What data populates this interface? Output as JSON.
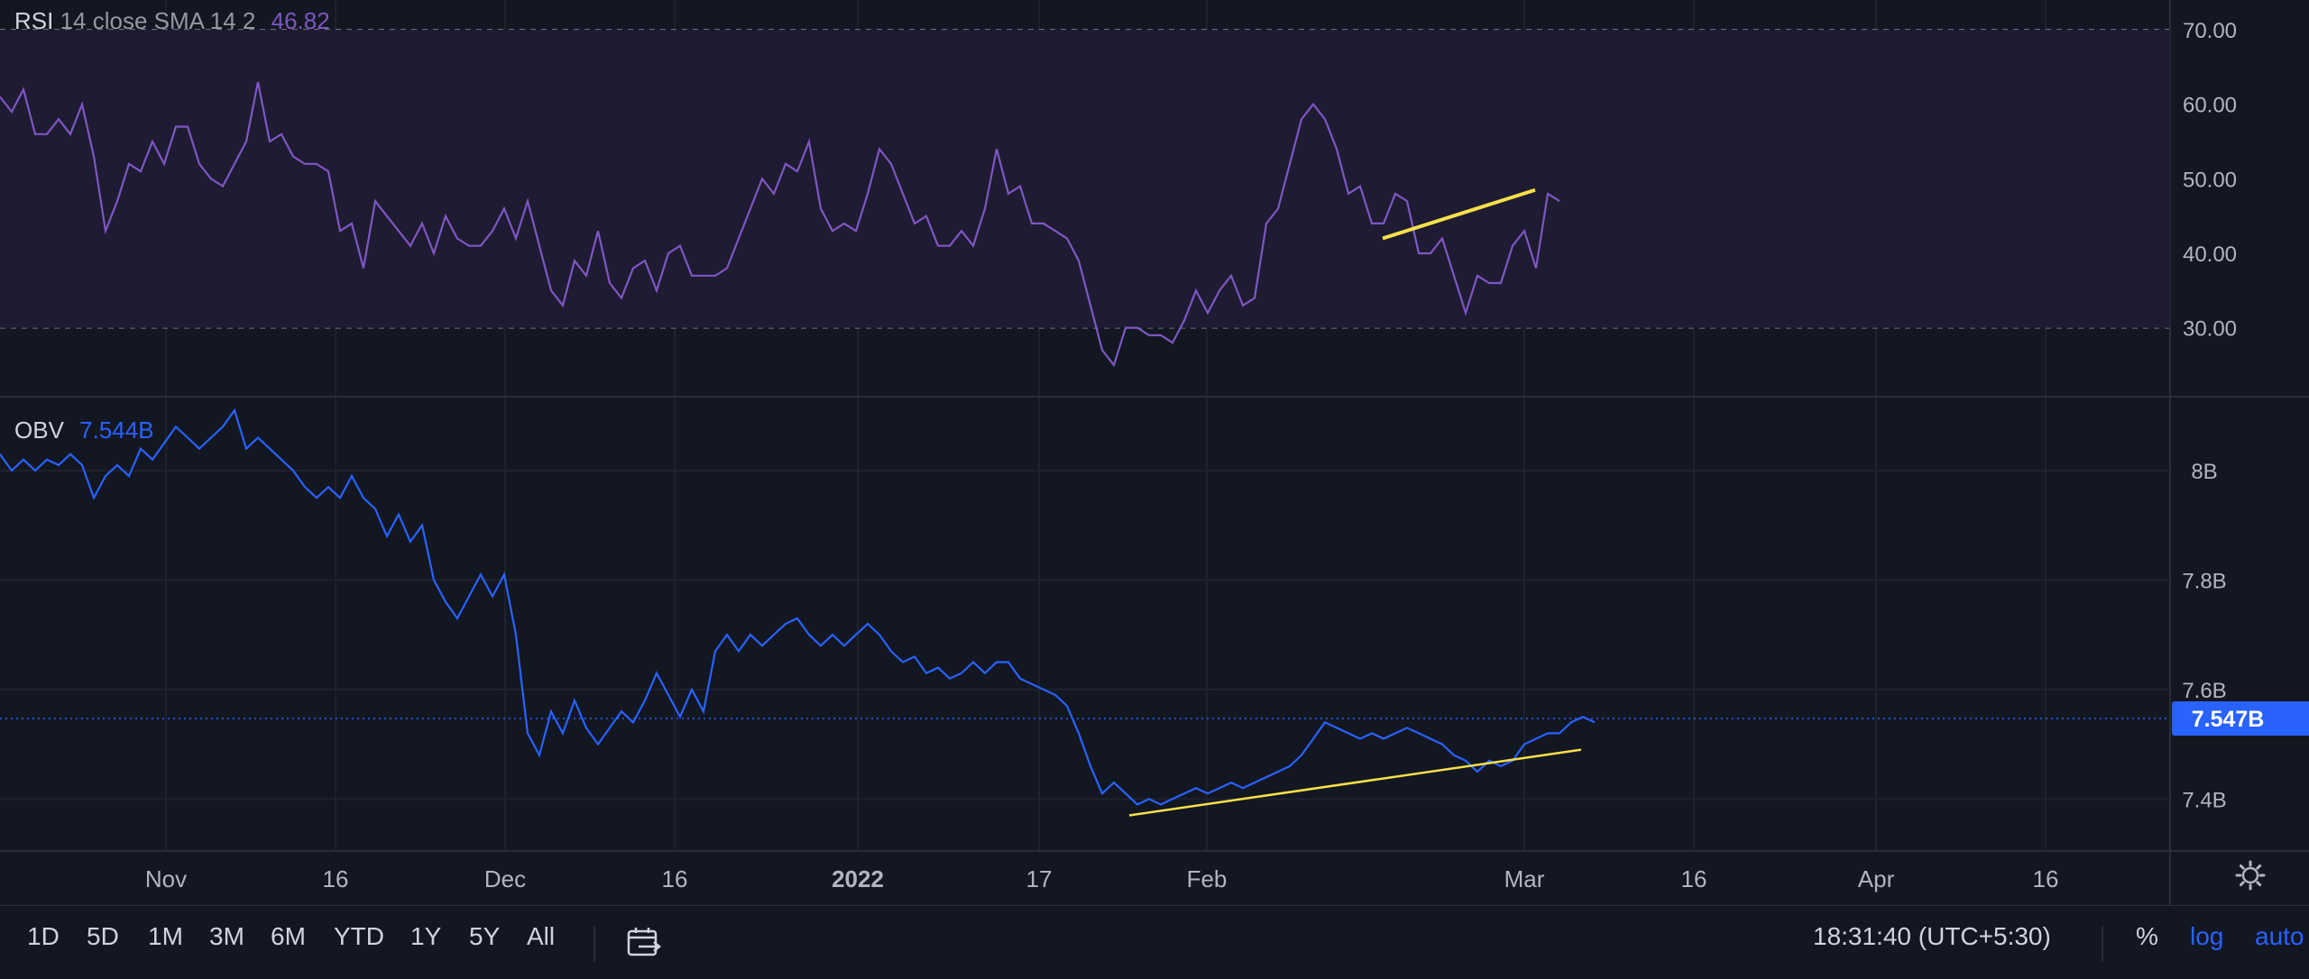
{
  "rsi_legend": {
    "name": "RSI",
    "params": "14 close SMA 14 2",
    "value": "46.82"
  },
  "obv_legend": {
    "name": "OBV",
    "value": "7.544B"
  },
  "obv_price_label": "7.547B",
  "toolbar": {
    "ranges": [
      "1D",
      "5D",
      "1M",
      "3M",
      "6M",
      "YTD",
      "1Y",
      "5Y",
      "All"
    ],
    "time": "18:31:40 (UTC+5:30)",
    "percent": "%",
    "log": "log",
    "auto": "auto"
  },
  "colors": {
    "rsi": "#7e57c2",
    "obv": "#2962ff",
    "trendline": "#f7e04a",
    "background": "#131722",
    "rsi_band": "#1f1b33"
  },
  "icons": {
    "gear": "gear-icon",
    "date_range": "calendar-range-icon"
  },
  "chart_data": [
    {
      "type": "line",
      "title": "RSI 14 close SMA 14 2",
      "x_ticks": [
        "Nov",
        "16",
        "Dec",
        "16",
        "2022",
        "17",
        "Feb",
        "Mar",
        "16",
        "Apr",
        "16"
      ],
      "y_ticks": [
        "70.00",
        "60.00",
        "50.00",
        "40.00",
        "30.00"
      ],
      "ylim": [
        21,
        74
      ],
      "band": [
        30,
        70
      ],
      "dashed_levels": [
        70,
        50,
        30
      ],
      "series": [
        {
          "values": [
            61,
            59,
            62,
            56,
            56,
            58,
            56,
            60,
            53,
            43,
            47,
            52,
            51,
            55,
            52,
            57,
            57,
            52,
            50,
            49,
            52,
            55,
            63,
            55,
            56,
            53,
            52,
            52,
            51,
            43,
            44,
            38,
            47,
            45,
            43,
            41,
            44,
            40,
            45,
            42,
            41,
            41,
            43,
            46,
            42,
            47,
            41,
            35,
            33,
            39,
            37,
            43,
            36,
            34,
            38,
            39,
            35,
            40,
            41,
            37,
            37,
            37,
            38,
            42,
            46,
            50,
            48,
            52,
            51,
            55,
            46,
            43,
            44,
            43,
            48,
            54,
            52,
            48,
            44,
            45,
            41,
            41,
            43,
            41,
            46,
            54,
            48,
            49,
            44,
            44,
            43,
            42,
            39,
            33,
            27,
            25,
            30,
            30,
            29,
            29,
            28,
            31,
            35,
            32,
            35,
            37,
            33,
            34,
            44,
            46,
            52,
            58,
            60,
            58,
            54,
            48,
            49,
            44,
            44,
            48,
            47,
            40,
            40,
            42,
            37,
            32,
            37,
            36,
            36,
            41,
            43,
            38,
            48,
            47
          ]
        }
      ],
      "trendlines": [
        {
          "from": [
            117,
            42
          ],
          "to": [
            128,
            48.5
          ]
        }
      ]
    },
    {
      "type": "line",
      "title": "OBV",
      "y_ticks": [
        "8B",
        "7.8B",
        "7.6B",
        "7.4B"
      ],
      "ylim": [
        7.305,
        8.135
      ],
      "last_value_label": "7.547B",
      "series": [
        {
          "values": [
            8.03,
            8.0,
            8.02,
            8.0,
            8.02,
            8.01,
            8.03,
            8.01,
            7.95,
            7.99,
            8.01,
            7.99,
            8.04,
            8.02,
            8.05,
            8.08,
            8.06,
            8.04,
            8.06,
            8.08,
            8.11,
            8.04,
            8.06,
            8.04,
            8.02,
            8.0,
            7.97,
            7.95,
            7.97,
            7.95,
            7.99,
            7.95,
            7.93,
            7.88,
            7.92,
            7.87,
            7.9,
            7.8,
            7.76,
            7.73,
            7.77,
            7.81,
            7.77,
            7.81,
            7.7,
            7.52,
            7.48,
            7.56,
            7.52,
            7.58,
            7.53,
            7.5,
            7.53,
            7.56,
            7.54,
            7.58,
            7.63,
            7.59,
            7.55,
            7.6,
            7.56,
            7.67,
            7.7,
            7.67,
            7.7,
            7.68,
            7.7,
            7.72,
            7.73,
            7.7,
            7.68,
            7.7,
            7.68,
            7.7,
            7.72,
            7.7,
            7.67,
            7.65,
            7.66,
            7.63,
            7.64,
            7.62,
            7.63,
            7.65,
            7.63,
            7.65,
            7.65,
            7.62,
            7.61,
            7.6,
            7.59,
            7.57,
            7.52,
            7.46,
            7.41,
            7.43,
            7.41,
            7.39,
            7.4,
            7.39,
            7.4,
            7.41,
            7.42,
            7.41,
            7.42,
            7.43,
            7.42,
            7.43,
            7.44,
            7.45,
            7.46,
            7.48,
            7.51,
            7.54,
            7.53,
            7.52,
            7.51,
            7.52,
            7.51,
            7.52,
            7.53,
            7.52,
            7.51,
            7.5,
            7.48,
            7.47,
            7.45,
            7.47,
            7.46,
            7.47,
            7.5,
            7.51,
            7.52,
            7.52,
            7.54,
            7.55,
            7.54
          ]
        }
      ],
      "trendlines": [
        {
          "from": [
            94,
            7.37
          ],
          "to": [
            131,
            7.49
          ]
        }
      ]
    }
  ]
}
